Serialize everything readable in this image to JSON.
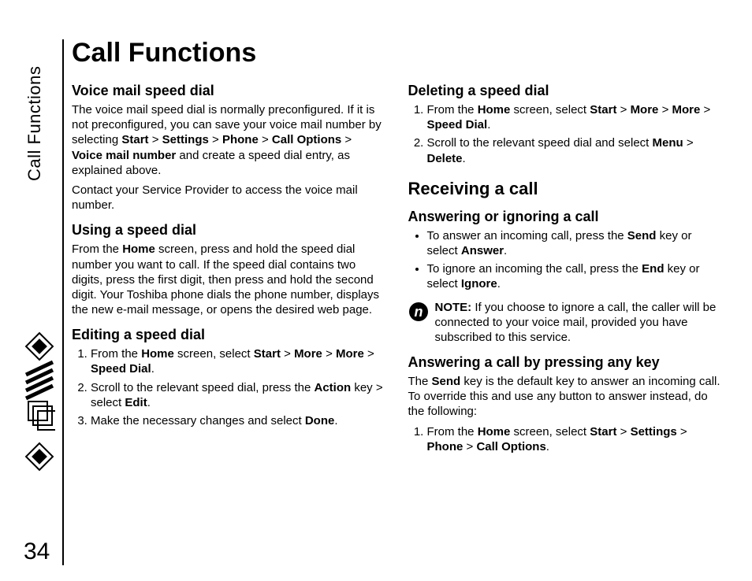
{
  "meta": {
    "side_label": "Call Functions",
    "page_number": "34",
    "chapter_title": "Call Functions"
  },
  "left": {
    "voice_mail": {
      "heading": "Voice mail speed dial",
      "p1_a": "The voice mail speed dial is normally preconfigured. If it is not preconfigured, you can save your voice mail number by selecting ",
      "p1_b_start": "Start",
      "gt1": " > ",
      "p1_b_settings": "Settings",
      "p1_b_phone": "Phone",
      "p1_b_calloptions": "Call Options",
      "p1_b_vmn": "Voice mail number",
      "p1_c": " and create a speed dial entry, as explained above.",
      "p2": "Contact your Service Provider to access the    voice mail number."
    },
    "using": {
      "heading": "Using a speed dial",
      "p1_a": "From the ",
      "p1_home": "Home",
      "p1_b": " screen, press and hold the speed dial number you want to call. If the speed dial contains two digits, press the first digit, then press and hold the second digit. Your Toshiba phone dials the phone number, displays the new e-mail message, or opens the desired web page."
    },
    "editing": {
      "heading": "Editing a speed dial",
      "step1_a": "From the ",
      "step1_home": "Home",
      "step1_b": " screen, select ",
      "step1_start": "Start",
      "gt": " > ",
      "step1_more1": "More",
      "step1_more2": "More",
      "step1_sd": "Speed Dial",
      "step1_end": ".",
      "step2_a": "Scroll to the relevant speed dial, press the ",
      "step2_action": "Action",
      "step2_b": " key > select ",
      "step2_edit": "Edit",
      "step2_end": ".",
      "step3_a": "Make the necessary changes and select ",
      "step3_done": "Done",
      "step3_end": "."
    }
  },
  "right": {
    "deleting": {
      "heading": "Deleting a speed dial",
      "step1_a": "From the ",
      "step1_home": "Home",
      "step1_b": " screen, select ",
      "step1_start": "Start",
      "gt": " > ",
      "step1_more1": "More",
      "step1_more2": "More",
      "step1_sd": "Speed Dial",
      "step1_end": ".",
      "step2_a": "Scroll to the relevant speed dial and select ",
      "step2_menu": "Menu",
      "step2_gt": " > ",
      "step2_delete": "Delete",
      "step2_end": "."
    },
    "receiving": {
      "heading": "Receiving a call"
    },
    "answering": {
      "heading": "Answering or ignoring a call",
      "b1_a": "To answer an incoming call, press the ",
      "b1_send": "Send",
      "b1_b": " key or select ",
      "b1_answer": "Answer",
      "b1_end": ".",
      "b2_a": "To ignore an incoming the call, press the ",
      "b2_end_key": "End",
      "b2_b": " key or select ",
      "b2_ignore": "Ignore",
      "b2_end": "."
    },
    "note": {
      "label": "NOTE:",
      "text": " If you choose to ignore a call, the caller will be connected to your voice mail, provided you have subscribed to this service."
    },
    "anykey": {
      "heading": "Answering a call by pressing any key",
      "p1_a": "The ",
      "p1_send": "Send",
      "p1_b": " key is the default key to answer an incoming call. To override this and use any button to answer instead, do the following:",
      "step1_a": "From the ",
      "step1_home": "Home",
      "step1_b": " screen, select ",
      "step1_start": "Start",
      "gt": " > ",
      "step1_settings": "Settings",
      "step1_phone": "Phone",
      "step1_calloptions": "Call Options",
      "step1_end": "."
    }
  }
}
